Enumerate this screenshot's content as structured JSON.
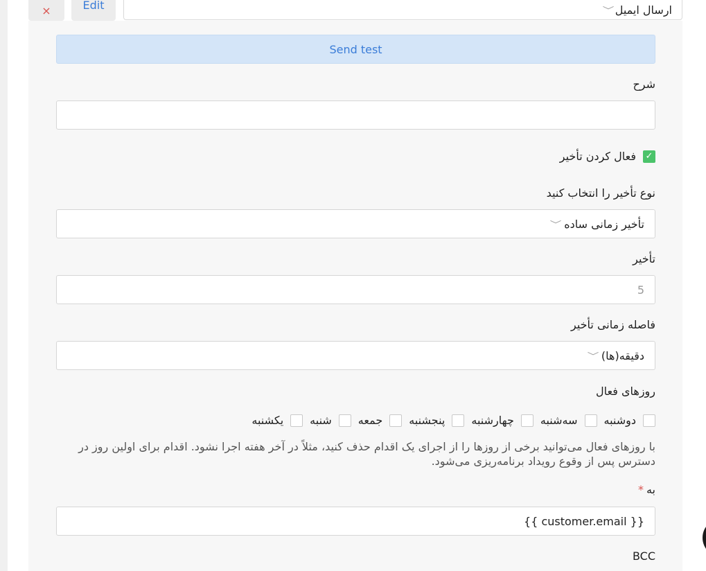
{
  "top": {
    "close_icon": "×",
    "edit_label": "Edit",
    "action_select_value": "ارسال ایمیل"
  },
  "send_test_label": "Send test",
  "description": {
    "label": "شرح",
    "value": ""
  },
  "delay_enabled": {
    "label": "فعال کردن تأخیر",
    "checked": true
  },
  "delay_type": {
    "label": "نوع تأخیر را انتخاب کنید",
    "value": "تأخیر زمانی ساده"
  },
  "delay": {
    "label": "تأخیر",
    "placeholder": "5"
  },
  "delay_interval": {
    "label": "فاصله زمانی تأخیر",
    "value": "دقیقه(ها)"
  },
  "active_days": {
    "label": "روزهای فعال",
    "days": [
      "دوشنبه",
      "سه‌شنبه",
      "چهارشنبه",
      "پنجشنبه",
      "جمعه",
      "شنبه",
      "یکشنبه"
    ],
    "help_text": "با روزهای فعال می‌توانید برخی از روزها را از اجرای یک اقدام حذف کنید، مثلاً در آخر هفته اجرا نشود. اقدام برای اولین روز در دسترس پس از وقوع رویداد برنامه‌ریزی می‌شود."
  },
  "to": {
    "label": "به",
    "required_mark": "*",
    "value": "{{ customer.email }}"
  },
  "bcc": {
    "label": "BCC"
  },
  "colors": {
    "accent_blue": "#3b7dd8",
    "send_test_bg": "#d4e5f8",
    "check_green": "#4bc36a",
    "danger_red": "#d9534f"
  }
}
